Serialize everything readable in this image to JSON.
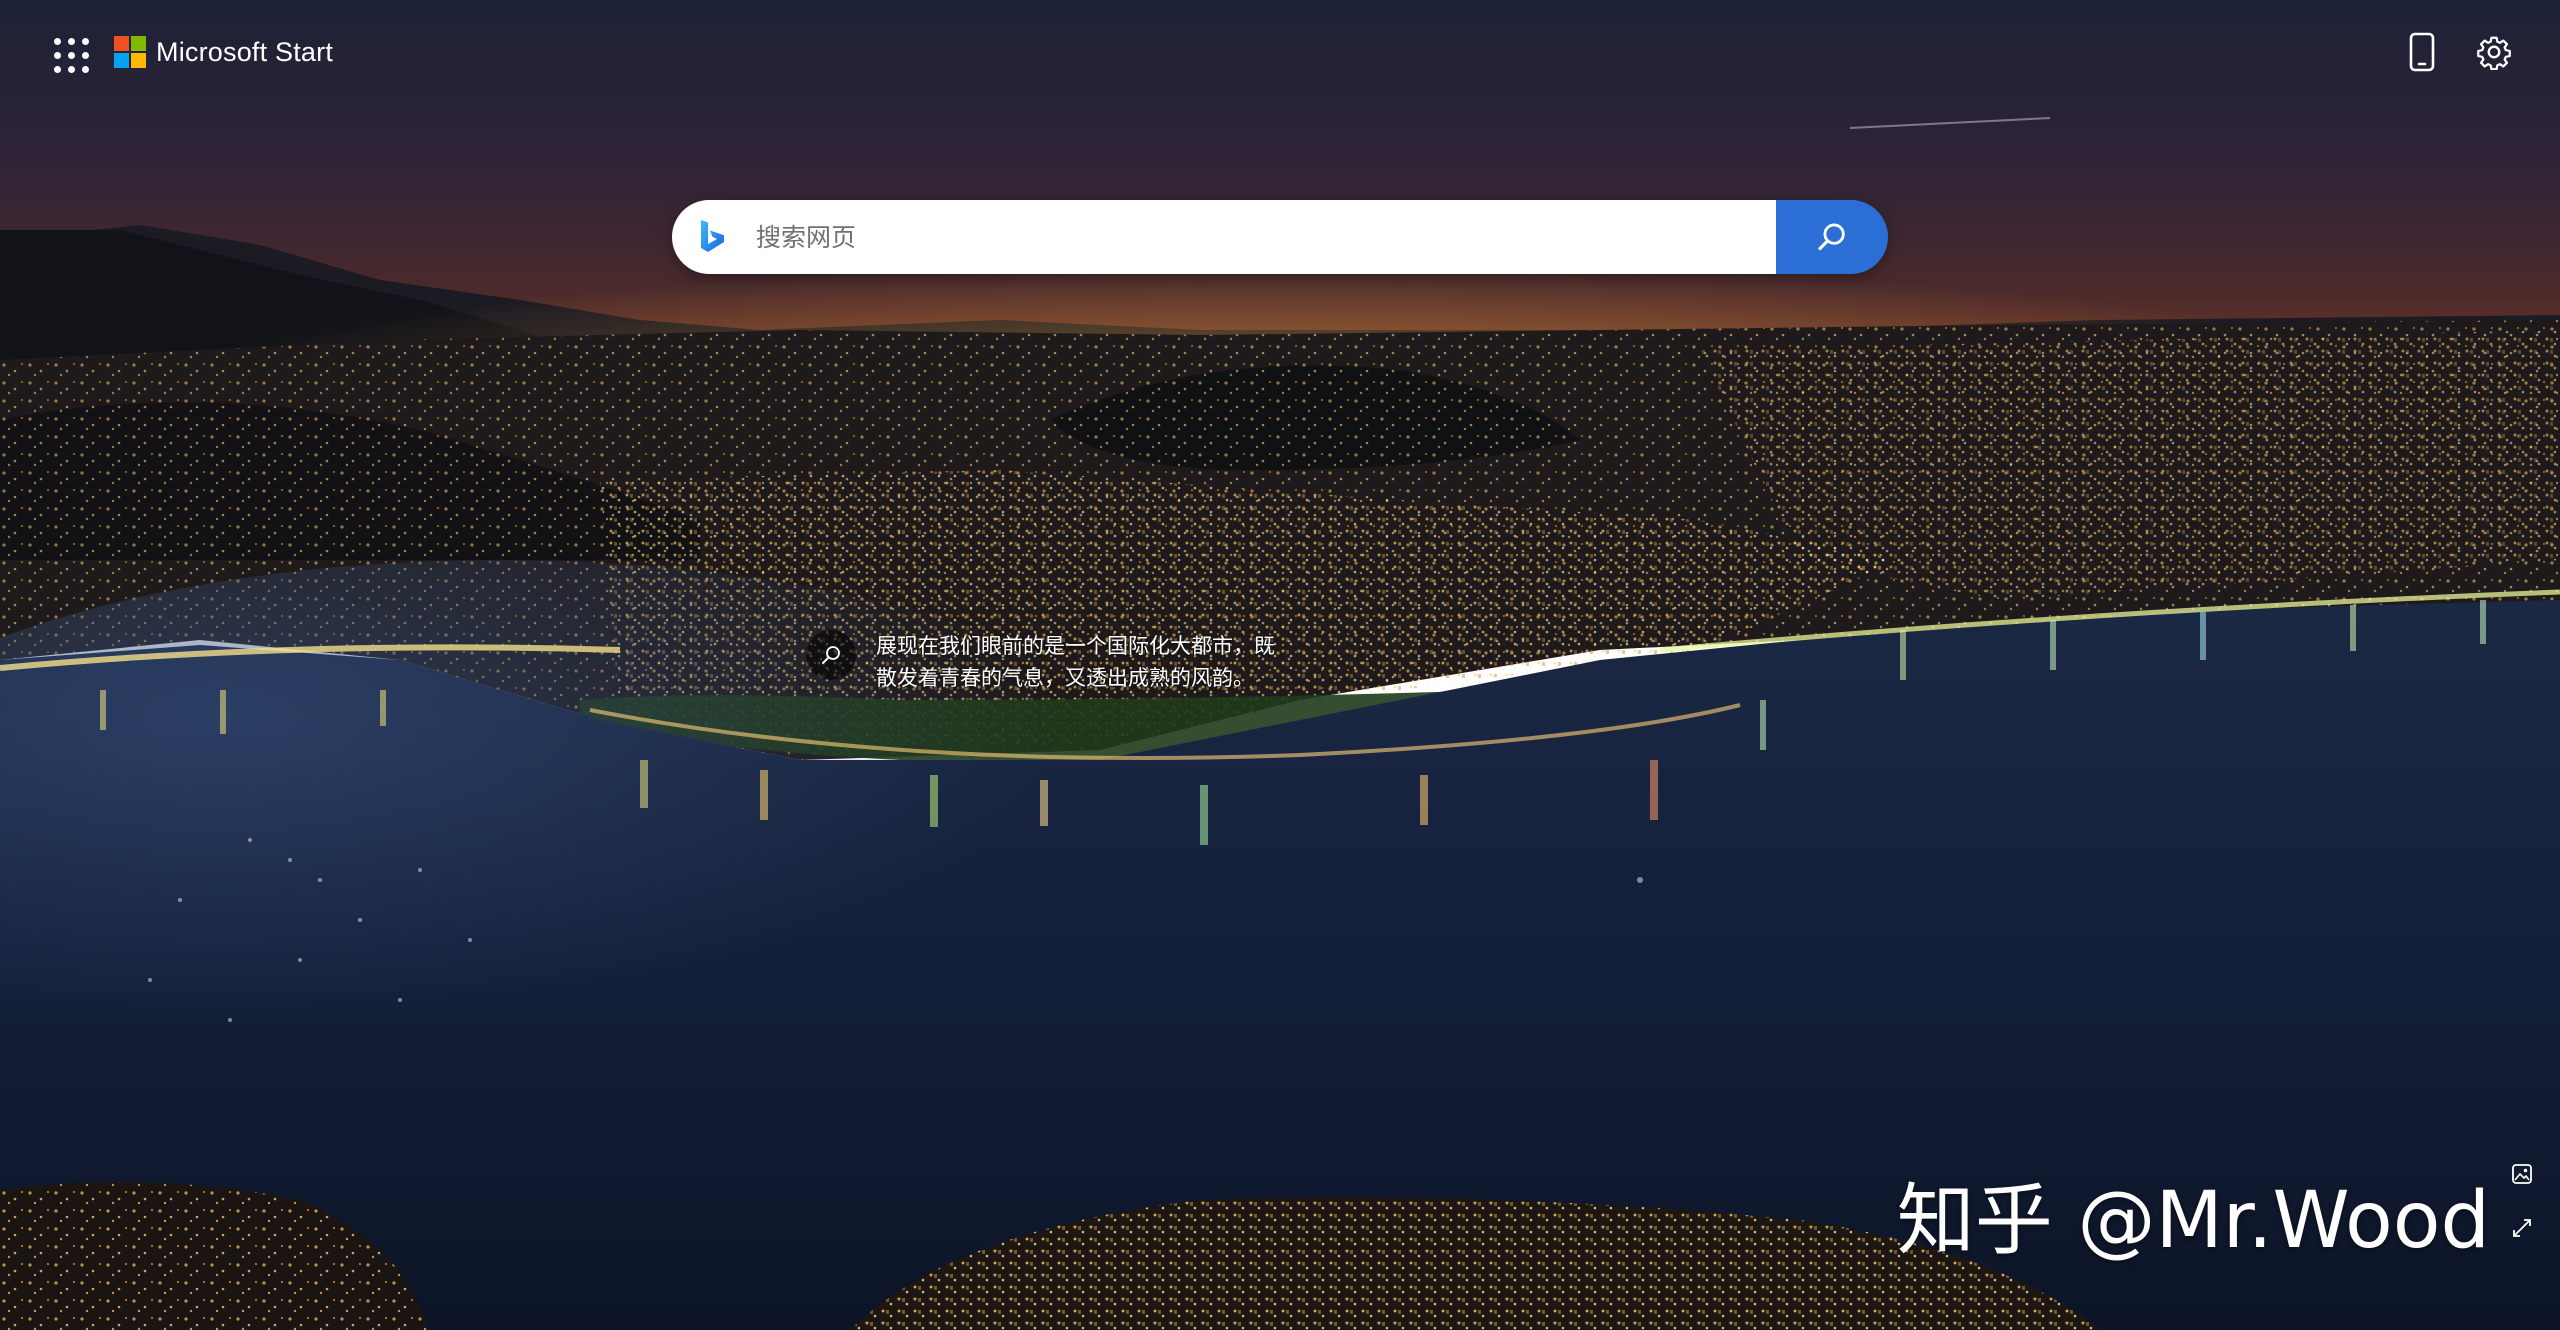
{
  "header": {
    "apps_icon": "waffle-grid-icon",
    "brand_name": "Microsoft Start",
    "logo_colors": [
      "#f25022",
      "#7fba00",
      "#00a4ef",
      "#ffb900"
    ],
    "phone_icon": "phone-icon",
    "settings_icon": "gear-icon"
  },
  "search": {
    "placeholder": "搜索网页",
    "value": "",
    "engine_icon": "bing-logo-icon",
    "button_icon": "search-icon",
    "accent_color": "#2b6fd6"
  },
  "image_info": {
    "icon": "magnifier-icon",
    "caption": "展现在我们眼前的是一个国际化大都市，既散发着青春的气息，又透出成熟的风韵。"
  },
  "controls": {
    "image_icon": "image-icon",
    "expand_icon": "expand-icon"
  },
  "watermark": {
    "text": "知乎 @Mr.Wood"
  }
}
